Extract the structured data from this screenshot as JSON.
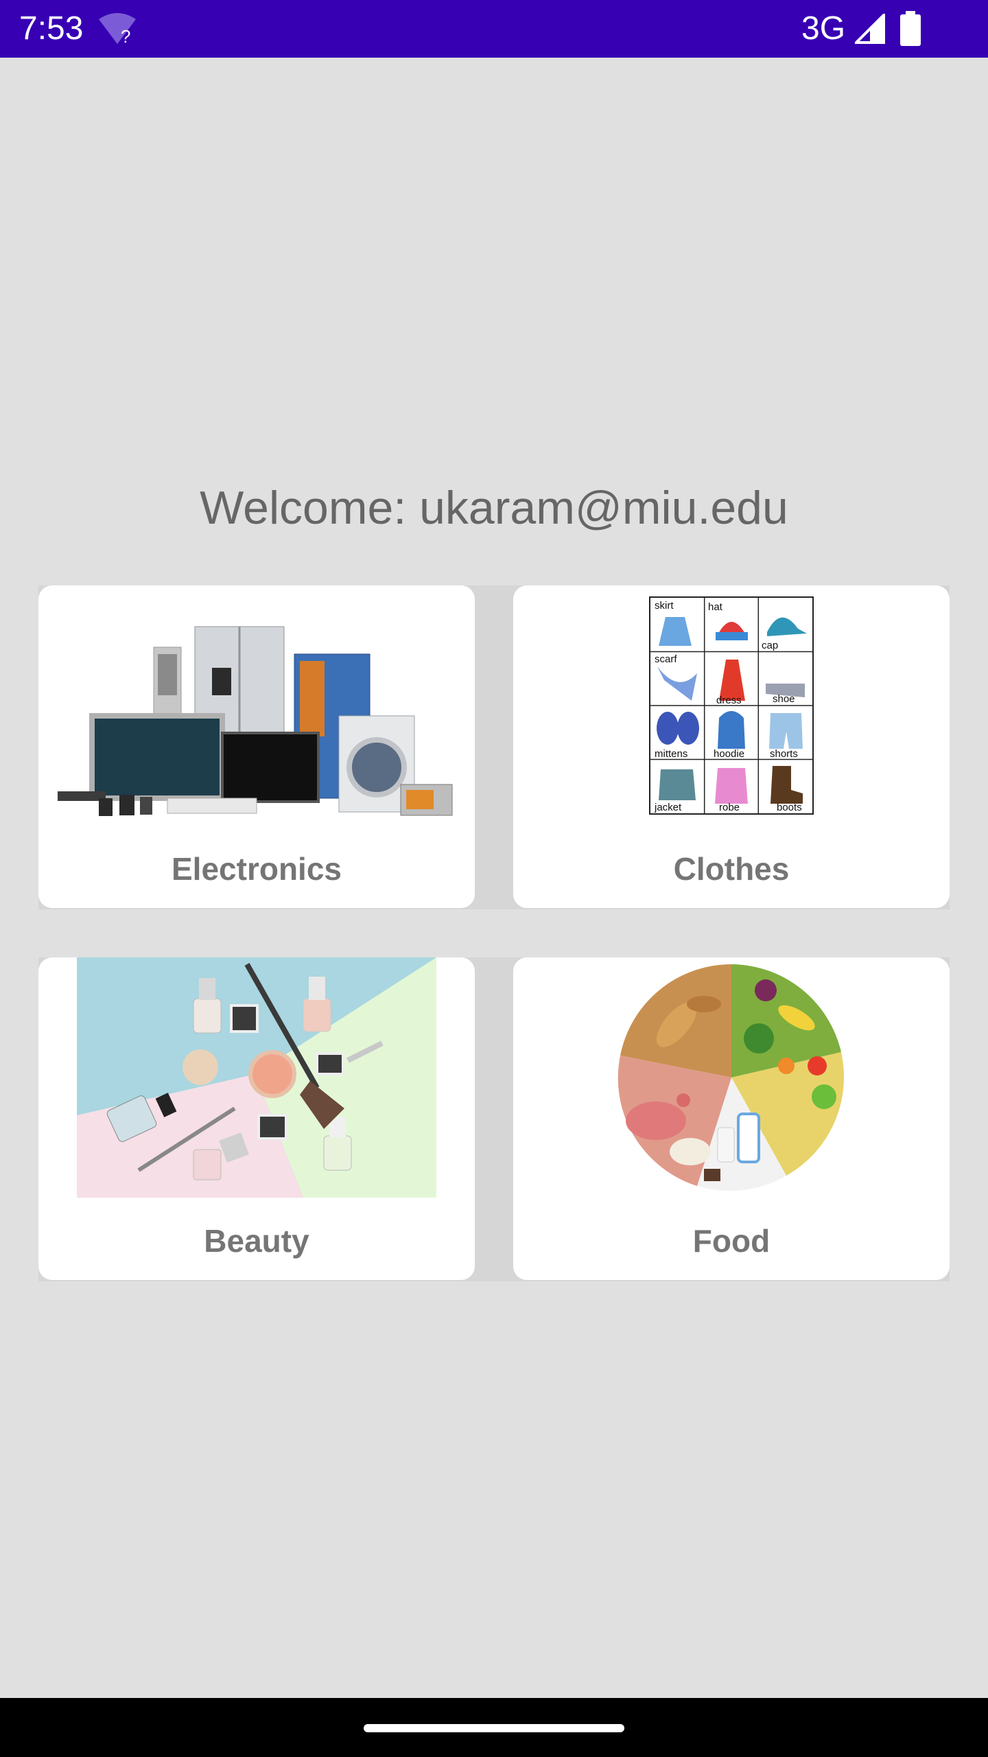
{
  "status_bar": {
    "time": "7:53",
    "wifi_badge": "?",
    "network": "3G",
    "icons": [
      "wifi-unknown-icon",
      "signal-icon",
      "battery-icon"
    ],
    "background": "#3700b3"
  },
  "welcome": {
    "text": "Welcome: ukaram@miu.edu"
  },
  "categories": [
    {
      "label": "Electronics",
      "image": "electronics-appliances-image"
    },
    {
      "label": "Clothes",
      "image": "clothes-vocabulary-chart-image"
    },
    {
      "label": "Beauty",
      "image": "cosmetics-flatlay-image"
    },
    {
      "label": "Food",
      "image": "food-groups-wheel-image"
    }
  ],
  "clothes_chart": {
    "labels": [
      "skirt",
      "hat",
      "cap",
      "scarf",
      "dress",
      "shoe",
      "mittens",
      "hoodie",
      "shorts",
      "jacket",
      "robe",
      "boots"
    ]
  }
}
